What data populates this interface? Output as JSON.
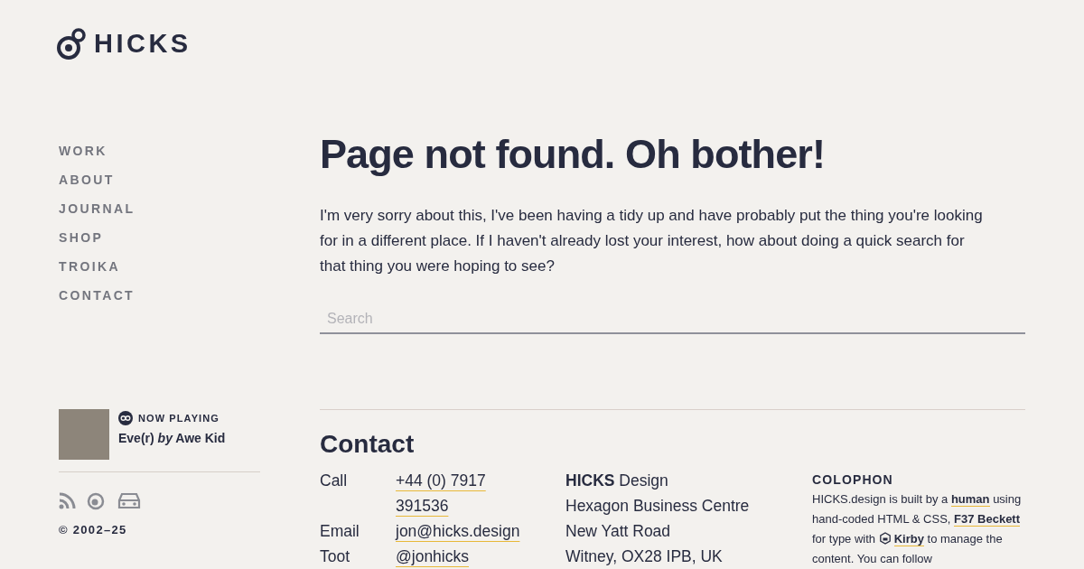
{
  "logo": {
    "text": "HICKS"
  },
  "nav": [
    {
      "label": "WORK"
    },
    {
      "label": "ABOUT"
    },
    {
      "label": "JOURNAL"
    },
    {
      "label": "SHOP"
    },
    {
      "label": "TROIKA"
    },
    {
      "label": "CONTACT"
    }
  ],
  "now_playing": {
    "label": "NOW PLAYING",
    "track": "Eve(r) *by* Awe Kid"
  },
  "copyright": "© 2002–25",
  "heading": "Page not found. Oh bother!",
  "intro": "I'm very sorry about this, I've been having a tidy up and have probably put the thing you're looking for in a different place. If I haven't already lost your interest, how about doing a quick search for that thing you were hoping to see?",
  "search": {
    "placeholder": "Search"
  },
  "contact": {
    "title": "Contact",
    "rows": [
      {
        "label": "Call",
        "value": "+44 (0) 7917 391536"
      },
      {
        "label": "Email",
        "value": "jon@hicks.design"
      },
      {
        "label": "Toot",
        "value": "@jonhicks"
      }
    ],
    "address": [
      "**HICKS** Design",
      "Hexagon Business Centre",
      "New Yatt Road",
      "Witney, OX28 IPB, UK"
    ]
  },
  "colophon": {
    "title": "COLOPHON",
    "segments": [
      {
        "kind": "text",
        "text": "HICKS.design is built by a "
      },
      {
        "kind": "link",
        "text": "human"
      },
      {
        "kind": "text",
        "text": " using hand-coded HTML & CSS, "
      },
      {
        "kind": "link",
        "text": "F37 Beckett"
      },
      {
        "kind": "text",
        "text": " for type with "
      },
      {
        "kind": "icon-link",
        "text": "Kirby"
      },
      {
        "kind": "text",
        "text": " to manage the content. You can follow"
      }
    ]
  }
}
